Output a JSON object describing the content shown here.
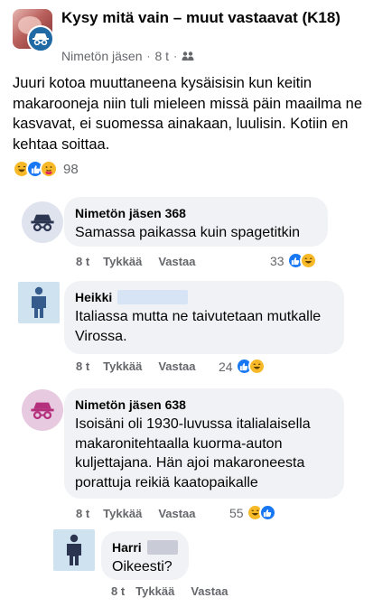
{
  "post": {
    "group_title": "Kysy mitä vain – muut vastaavat (K18)",
    "author": "Nimetön jäsen",
    "time": "8 t",
    "separator": "·",
    "text": "Juuri kotoa muuttaneena kysäisisin kun keitin makarooneja niin tuli mieleen missä päin maailma ne kasvavat, ei suomessa ainakaan, luulisin. Kotiin en kehtaa soittaa.",
    "reactions": [
      "haha-icon",
      "like-icon",
      "care-icon"
    ],
    "reaction_count": "98"
  },
  "comments": [
    {
      "author": "Nimetön jäsen 368",
      "text": "Samassa paikassa kuin spagetitkin",
      "time": "8 t",
      "like_label": "Tykkää",
      "reply_label": "Vastaa",
      "reaction_count": "33",
      "reactions": [
        "like-icon",
        "haha-icon"
      ]
    },
    {
      "author": "Heikki",
      "text": "Italiassa mutta ne taivutetaan mutkalle Virossa.",
      "time": "8 t",
      "like_label": "Tykkää",
      "reply_label": "Vastaa",
      "reaction_count": "24",
      "reactions": [
        "like-icon",
        "haha-icon"
      ]
    },
    {
      "author": "Nimetön jäsen 638",
      "text": "Isoisäni oli 1930-luvussa italialaisella makaronitehtaalla kuorma-auton kuljettajana. Hän ajoi makaroneesta porattuja reikiä kaatopaikalle",
      "time": "8 t",
      "like_label": "Tykkää",
      "reply_label": "Vastaa",
      "reaction_count": "55",
      "reactions": [
        "haha-icon",
        "like-icon"
      ]
    },
    {
      "author": "Harri",
      "text": "Oikeesti?",
      "time": "8 t",
      "like_label": "Tykkää",
      "reply_label": "Vastaa"
    }
  ],
  "colors": {
    "like_blue": "#1877f2",
    "haha_yellow": "#f7b928",
    "bubble_gray": "#f0f2f5",
    "meta_gray": "#65676b",
    "anon_pink": "#b4307c",
    "anon_navy": "#2c3550"
  }
}
